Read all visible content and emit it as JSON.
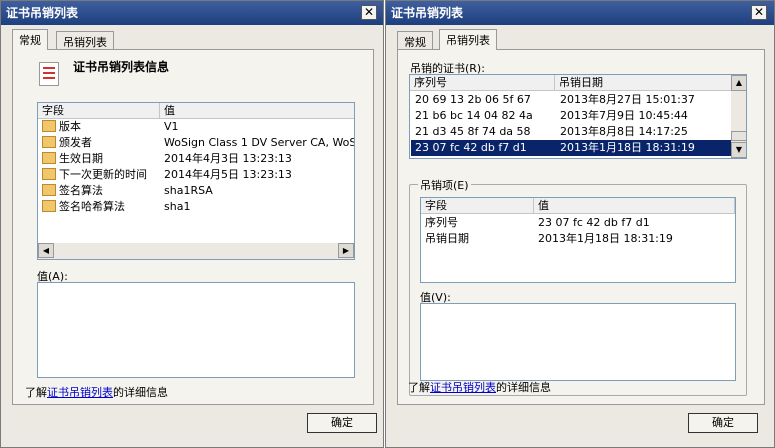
{
  "left": {
    "title": "证书吊销列表",
    "tabs": [
      "常规",
      "吊销列表"
    ],
    "header_title": "证书吊销列表信息",
    "columns": [
      "字段",
      "值"
    ],
    "rows": [
      {
        "field": "版本",
        "value": "V1"
      },
      {
        "field": "颁发者",
        "value": "WoSign Class 1 DV Server CA, WoS..."
      },
      {
        "field": "生效日期",
        "value": "2014年4月3日 13:23:13"
      },
      {
        "field": "下一次更新的时间",
        "value": "2014年4月5日 13:23:13"
      },
      {
        "field": "签名算法",
        "value": "sha1RSA"
      },
      {
        "field": "签名哈希算法",
        "value": "sha1"
      }
    ],
    "value_label": "值(A):",
    "learn_prefix": "了解",
    "learn_link": "证书吊销列表",
    "learn_suffix": "的详细信息",
    "ok": "确定"
  },
  "right": {
    "title": "证书吊销列表",
    "tabs": [
      "常规",
      "吊销列表"
    ],
    "revoked_label": "吊销的证书(R):",
    "revoked_columns": [
      "序列号",
      "吊销日期"
    ],
    "revoked_rows": [
      {
        "serial": "20 69 13 2b 06 5f 67",
        "date": "2013年8月27日 15:01:37"
      },
      {
        "serial": "21 b6 bc 14 04 82 4a",
        "date": "2013年7月9日 10:45:44"
      },
      {
        "serial": "21 d3 45 8f 74 da 58",
        "date": "2013年8月8日 14:17:25"
      },
      {
        "serial": "23 07 fc 42 db f7 d1",
        "date": "2013年1月18日 18:31:19"
      }
    ],
    "entry_group": "吊销项(E)",
    "entry_columns": [
      "字段",
      "值"
    ],
    "entry_rows": [
      {
        "field": "序列号",
        "value": "23 07 fc 42 db f7 d1"
      },
      {
        "field": "吊销日期",
        "value": "2013年1月18日 18:31:19"
      }
    ],
    "value_label": "值(V):",
    "learn_prefix": "了解",
    "learn_link": "证书吊销列表",
    "learn_suffix": "的详细信息",
    "ok": "确定"
  },
  "close_glyph": "✕",
  "arrows": {
    "up": "▲",
    "down": "▼",
    "left": "◀",
    "right": "▶"
  }
}
